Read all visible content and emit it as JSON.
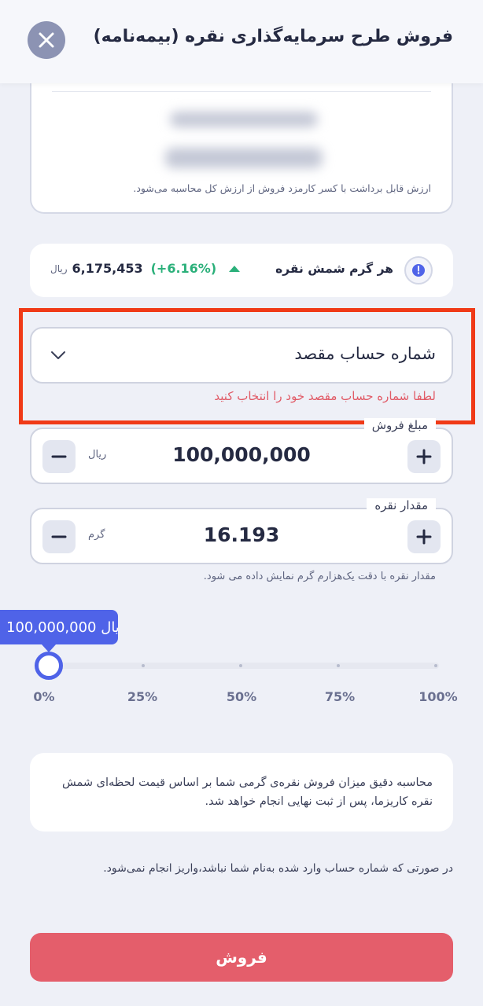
{
  "header": {
    "title": "فروش طرح سرمایه‌گذاری نقره (بیمه‌نامه)"
  },
  "summary_card": {
    "note": "ارزش قابل برداشت با کسر کارمزد فروش از ارزش کل محاسبه می‌شود."
  },
  "price": {
    "label": "هر گرم شمش نقره",
    "value": "6,175,453",
    "change": "(+6.16%)",
    "currency": "ریال",
    "change_color": "#2bb07a"
  },
  "destination": {
    "label": "شماره حساب مقصد",
    "error": "لطفا شماره حساب مقصد خود را انتخاب کنید"
  },
  "sale_amount": {
    "legend": "مبلغ فروش",
    "value": "100,000,000",
    "unit": "ریال"
  },
  "silver_amount": {
    "legend": "مقدار نقره",
    "value": "16.193",
    "unit": "گرم",
    "note": "مقدار نقره با دقت یک‌هزارم گرم نمایش داده می شود."
  },
  "slider": {
    "tooltip": "100,000,000 ریال",
    "value_percent": 0,
    "ticks": [
      "0%",
      "25%",
      "50%",
      "75%",
      "100%"
    ]
  },
  "info_text": "محاسبه دقیق میزان فروش نقره‌ی گرمی شما بر اساس قیمت لحظه‌ای شمش نقره کاریزما، پس از ثبت نهایی انجام خواهد شد.",
  "bottom_note": "در صورتی که شماره حساب وارد شده به‌نام شما نباشد،واریز انجام نمی‌شود.",
  "sell_button": "فروش",
  "colors": {
    "accent": "#4f63e8",
    "danger": "#e45e6b",
    "highlight": "#f03a17"
  }
}
